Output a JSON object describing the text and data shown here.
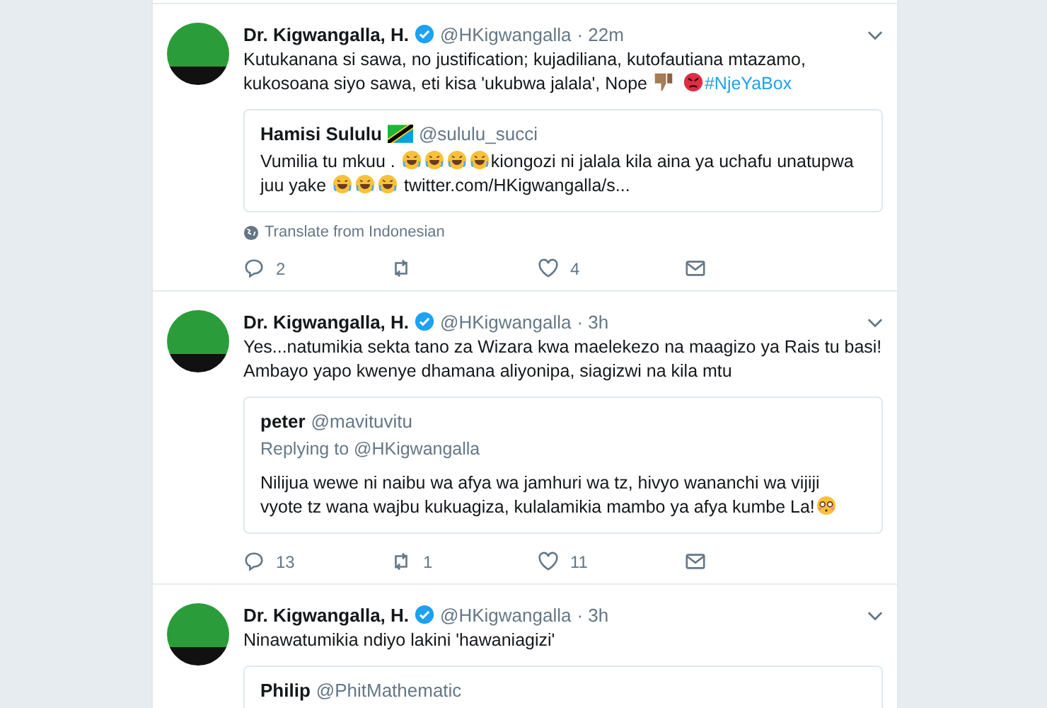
{
  "tweets": [
    {
      "name": "Dr. Kigwangalla, H.",
      "verified": true,
      "handle": "@HKigwangalla",
      "time": "· 22m",
      "text": [
        {
          "kind": "text",
          "text": "Kutukanana si sawa, no justification; kujadiliana, kutofautiana mtazamo, kukosoana siyo sawa, eti kisa 'ukubwa jalala', Nope "
        },
        {
          "kind": "thumbsdown"
        },
        {
          "kind": "angry"
        },
        {
          "kind": "link",
          "text": "#NjeYaBox"
        }
      ],
      "quote": {
        "name": "Hamisi Sululu",
        "name_flag": true,
        "handle": "@sululu_succi",
        "text": [
          {
            "kind": "text",
            "text": "Vumilia tu mkuu . "
          },
          {
            "kind": "laugh"
          },
          {
            "kind": "laugh"
          },
          {
            "kind": "laugh"
          },
          {
            "kind": "laugh"
          },
          {
            "kind": "text",
            "text": "kiongozi ni jalala kila aina ya uchafu unatupwa juu yake "
          },
          {
            "kind": "laugh"
          },
          {
            "kind": "laugh"
          },
          {
            "kind": "laugh"
          },
          {
            "kind": "text",
            "text": " twitter.com/HKigwangalla/s..."
          }
        ]
      },
      "translate": "Translate from Indonesian",
      "replies": "2",
      "likes": "4"
    },
    {
      "name": "Dr. Kigwangalla, H.",
      "verified": true,
      "handle": "@HKigwangalla",
      "time": "· 3h",
      "text": [
        {
          "kind": "text",
          "text": "Yes...natumikia sekta tano za Wizara kwa maelekezo na maagizo ya Rais tu basi! Ambayo yapo kwenye dhamana aliyonipa, siagizwi na kila mtu"
        }
      ],
      "quote": {
        "name": "peter",
        "handle": "@mavituvitu",
        "replying": "Replying to @HKigwangalla",
        "text": [
          {
            "kind": "text",
            "text": "Nilijua wewe ni naibu wa afya wa jamhuri wa tz, hivyo wananchi wa vijiji vyote tz wana wajbu kukuagiza, kulalamikia mambo ya afya kumbe La!"
          },
          {
            "kind": "flushed"
          }
        ]
      },
      "replies": "13",
      "retweets": "1",
      "likes": "11"
    },
    {
      "name": "Dr. Kigwangalla, H.",
      "verified": true,
      "handle": "@HKigwangalla",
      "time": "· 3h",
      "text": [
        {
          "kind": "text",
          "text": "Ninawatumikia ndiyo lakini 'hawaniagizi'"
        }
      ],
      "quote": {
        "name": "Philip",
        "handle": "@PhitMathematic"
      }
    }
  ]
}
